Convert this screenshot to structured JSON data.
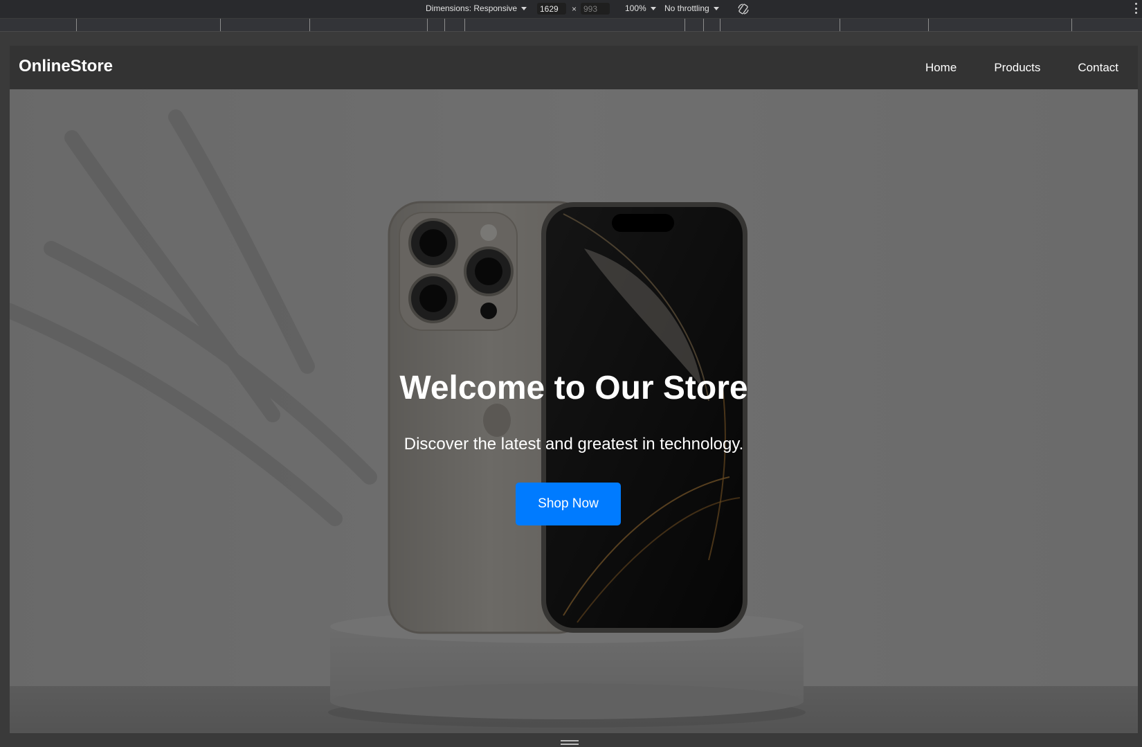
{
  "devtools": {
    "dimensions_label": "Dimensions: Responsive",
    "width_value": "1629",
    "height_placeholder": "993",
    "times": "×",
    "zoom": "100%",
    "throttling": "No throttling"
  },
  "site": {
    "logo": "OnlineStore",
    "nav": [
      "Home",
      "Products",
      "Contact"
    ],
    "hero": {
      "title": "Welcome to Our Store",
      "subtitle": "Discover the latest and greatest in technology.",
      "button": "Shop Now"
    }
  },
  "colors": {
    "navbar_bg": "#333333",
    "button_bg": "#007bff",
    "hero_overlay": "rgba(0,0,0,0.5)",
    "devtools_bg": "#292a2d"
  },
  "icons": [
    "dropdown-caret-icon",
    "rotate-device-icon",
    "more-options-icon",
    "resize-handle-icon"
  ]
}
